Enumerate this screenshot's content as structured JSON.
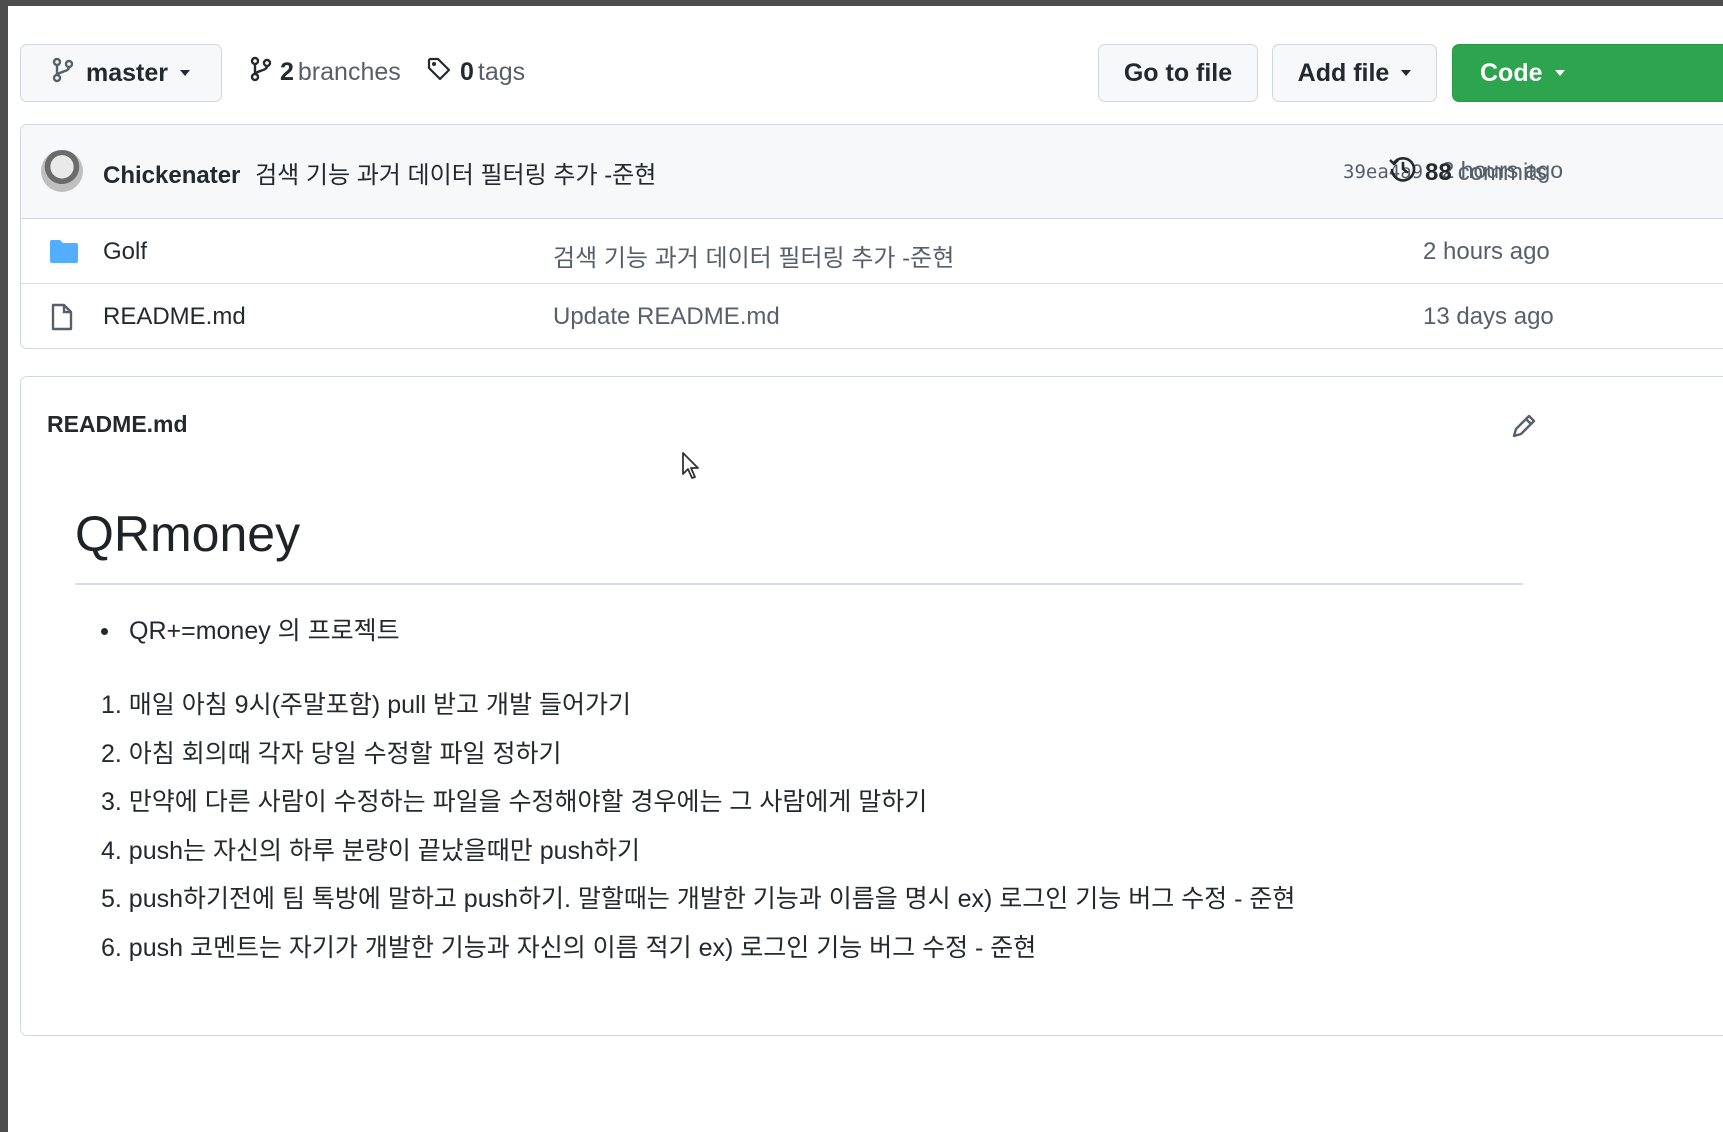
{
  "toolbar": {
    "branch": "master",
    "branches_count": "2",
    "branches_label": "branches",
    "tags_count": "0",
    "tags_label": "tags",
    "go_to_file": "Go to file",
    "add_file": "Add file",
    "code": "Code"
  },
  "commit": {
    "author": "Chickenater",
    "message": "검색 기능 과거 데이터 필터링 추가 -준현",
    "sha": "39ea4a9",
    "time": "2 hours ago",
    "commits_count": "88",
    "commits_label": "commits"
  },
  "files": [
    {
      "name": "Golf",
      "type": "folder",
      "message": "검색 기능 과거 데이터 필터링 추가 -준현",
      "age": "2 hours ago"
    },
    {
      "name": "README.md",
      "type": "file",
      "message": "Update README.md",
      "age": "13 days ago"
    }
  ],
  "readme": {
    "filename": "README.md",
    "heading": "QRmoney",
    "bullets": [
      "QR+=money 의 프로젝트"
    ],
    "steps": [
      "1. 매일 아침 9시(주말포함) pull 받고 개발 들어가기",
      "2. 아침 회의때 각자 당일 수정할 파일 정하기",
      "3. 만약에 다른 사람이 수정하는 파일을 수정해야할 경우에는 그 사람에게 말하기",
      "4. push는 자신의 하루 분량이 끝났을때만 push하기",
      "5. push하기전에 팀 톡방에 말하고 push하기. 말할때는 개발한 기능과 이름을 명시 ex) 로그인 기능 버그 수정 - 준현",
      "6. push 코멘트는 자기가 개발한 기능과 자신의 이름 적기 ex) 로그인 기능 버그 수정 - 준현"
    ]
  },
  "colors": {
    "code_button": "#2da44e",
    "folder_icon": "#54aeff",
    "page_border": "#4d4d4d"
  }
}
